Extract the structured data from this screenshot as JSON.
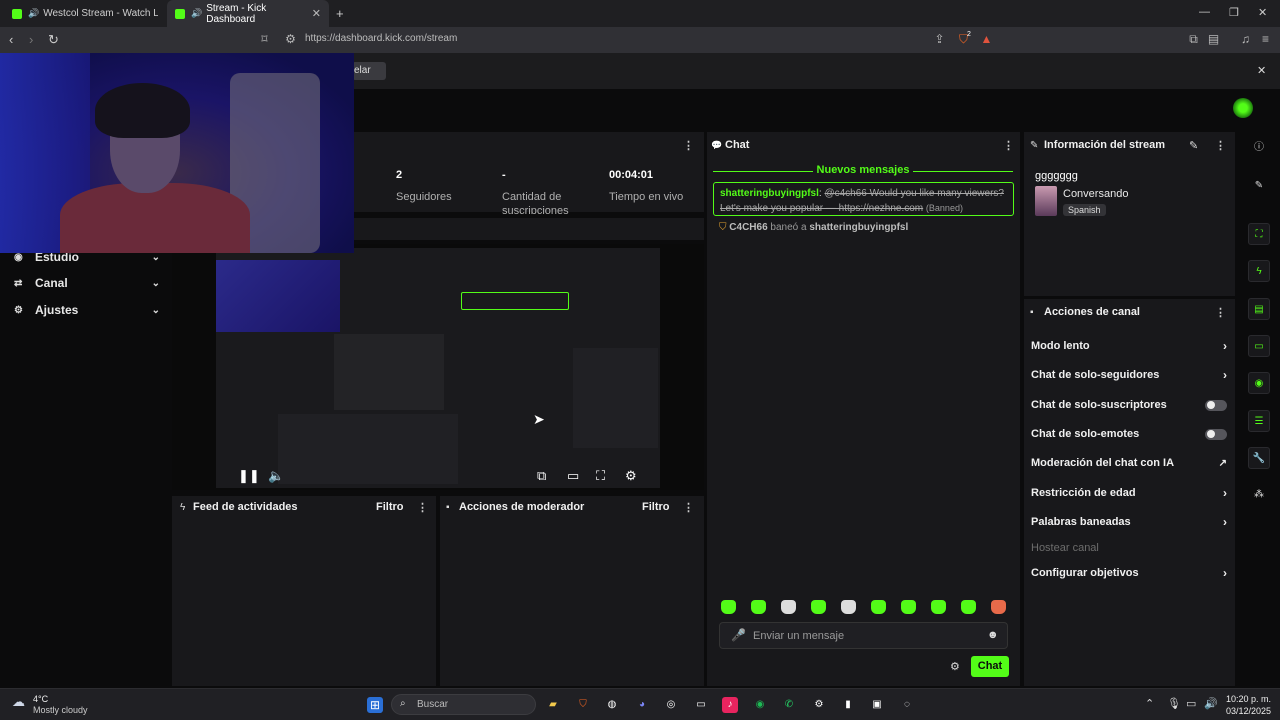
{
  "browser": {
    "tabs": [
      {
        "title": "Westcol Stream - Watch Live on K",
        "active": false
      },
      {
        "title": "Stream - Kick Dashboard",
        "active": true
      }
    ],
    "url": "https://dashboard.kick.com/stream",
    "brave_badge": "2"
  },
  "notice": {
    "button_label": "elar"
  },
  "sidebar": {
    "items": [
      {
        "label": "Estudio",
        "icon": "studio-icon"
      },
      {
        "label": "Canal",
        "icon": "channel-icon"
      },
      {
        "label": "Ajustes",
        "icon": "gear-icon"
      }
    ]
  },
  "stats": [
    {
      "value": "2",
      "label": "Seguidores"
    },
    {
      "value": "-",
      "label": "Cantidad de suscripciones"
    },
    {
      "value": "00:04:01",
      "label": "Tiempo en vivo"
    }
  ],
  "feed": {
    "title": "Feed de actividades",
    "filter": "Filtro"
  },
  "modactions": {
    "title": "Acciones de moderador",
    "filter": "Filtro"
  },
  "chat": {
    "title": "Chat",
    "new_messages": "Nuevos mensajes",
    "message": {
      "user": "shatteringbuyingpfsl",
      "text": "@c4ch66 Would you like many viewers? Let's make you popular — https://nezhne.com",
      "tag": "(Banned)"
    },
    "ban_line": {
      "actor": "C4CH66",
      "action": "baneó a",
      "target": "shatteringbuyingpfsl"
    },
    "input_placeholder": "Enviar un mensaje",
    "send_label": "Chat"
  },
  "stream_info": {
    "title": "Información del stream",
    "stream_title": "ggggggg",
    "category": "Conversando",
    "language": "Spanish"
  },
  "channel_actions": {
    "title": "Acciones de canal",
    "items": [
      {
        "label": "Modo lento",
        "control": "chevron"
      },
      {
        "label": "Chat de solo-seguidores",
        "control": "chevron"
      },
      {
        "label": "Chat de solo-suscriptores",
        "control": "toggle"
      },
      {
        "label": "Chat de solo-emotes",
        "control": "toggle"
      },
      {
        "label": "Moderación del chat con IA",
        "control": "external"
      },
      {
        "label": "Restricción de edad",
        "control": "chevron"
      },
      {
        "label": "Palabras baneadas",
        "control": "chevron"
      },
      {
        "label": "Hostear canal",
        "control": "disabled"
      },
      {
        "label": "Configurar objetivos",
        "control": "chevron"
      }
    ]
  },
  "taskbar": {
    "weather_temp": "4°C",
    "weather_desc": "Mostly cloudy",
    "search_placeholder": "Buscar",
    "time": "10:20 p. m.",
    "date": "03/12/2025"
  },
  "colors": {
    "accent": "#53fc18",
    "panel": "#18181b",
    "background": "#0b0b0c"
  }
}
